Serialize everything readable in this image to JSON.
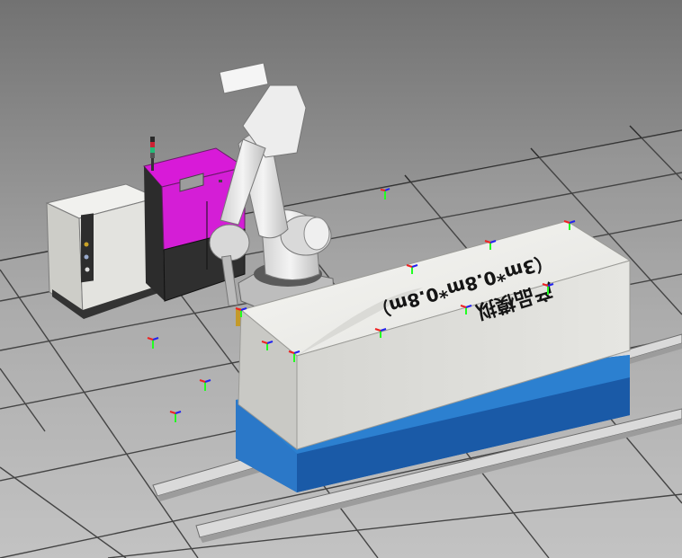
{
  "scene": {
    "box_label_line1": "产品模拟",
    "box_label_line2": "（3m*0.8m*0.8m）",
    "colors": {
      "background_top": "#6f6f6f",
      "background_bottom": "#c2c2c2",
      "floor": "#b8b8b8",
      "grid_line": "#2a2a2a",
      "product_box": "#ecece8",
      "base": "#1f63b5",
      "controller": "#d01ad8",
      "robot": "#e9e9e9",
      "rail": "#d6d6d6"
    },
    "icons": [
      "frame-axis-icon",
      "robot-arm",
      "signal-tower-icon"
    ]
  }
}
